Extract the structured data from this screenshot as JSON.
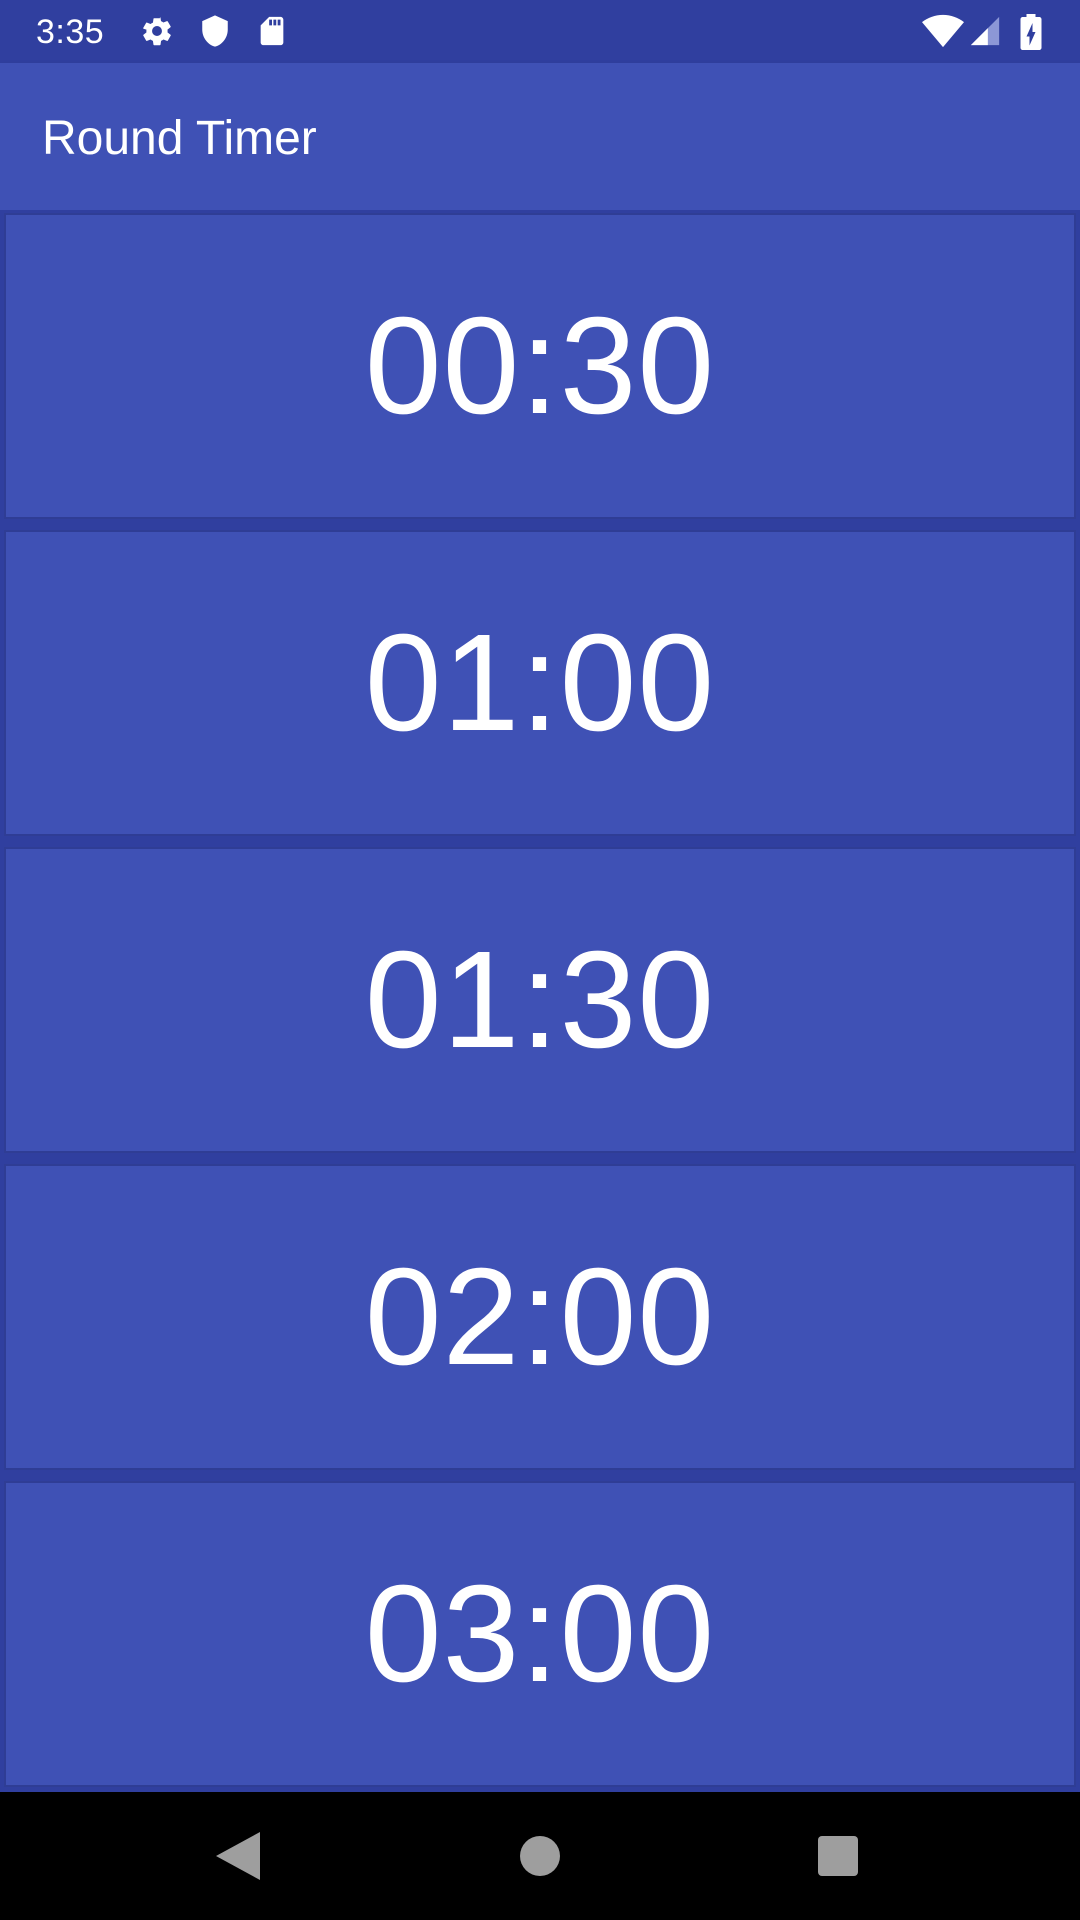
{
  "status_bar": {
    "time": "3:35",
    "icons_left": [
      "settings-icon",
      "shield-icon",
      "sd-card-icon"
    ],
    "icons_right": [
      "wifi-icon",
      "signal-icon",
      "battery-charging-icon"
    ]
  },
  "app_bar": {
    "title": "Round Timer",
    "color": "#3F51B5"
  },
  "timers": [
    {
      "label": "00:30"
    },
    {
      "label": "01:00"
    },
    {
      "label": "01:30"
    },
    {
      "label": "02:00"
    },
    {
      "label": "03:00"
    }
  ],
  "nav_bar": {
    "buttons": [
      "back-icon",
      "home-icon",
      "recents-icon"
    ]
  },
  "colors": {
    "primary": "#3F51B5",
    "primary_dark": "#303F9F",
    "text": "#FFFFFF"
  }
}
